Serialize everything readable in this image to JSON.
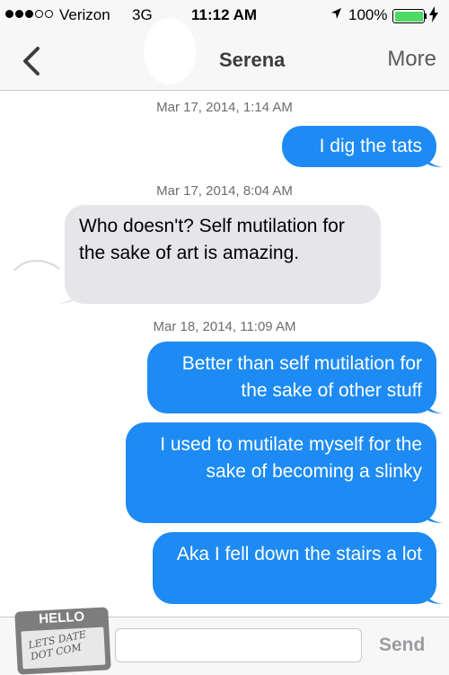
{
  "status_bar": {
    "carrier": "Verizon",
    "network": "3G",
    "time": "11:12 AM",
    "battery": "100%",
    "signal_bars": 3,
    "signal_total": 5
  },
  "nav": {
    "back_icon": "chevron-left-icon",
    "title": "Serena",
    "more_label": "More"
  },
  "messages": [
    {
      "type": "timestamp",
      "text": "Mar 17, 2014, 1:14 AM"
    },
    {
      "type": "sent",
      "text": "I dig the tats"
    },
    {
      "type": "timestamp",
      "text": "Mar 17, 2014, 8:04 AM"
    },
    {
      "type": "received",
      "text": "Who doesn't?  Self mutilation for the sake of art is amazing."
    },
    {
      "type": "timestamp",
      "text": "Mar 18, 2014, 11:09 AM"
    },
    {
      "type": "sent",
      "text": "Better than self mutilation for the sake of other stuff"
    },
    {
      "type": "sent",
      "text": "I used to mutilate myself for the sake of becoming a slinky"
    },
    {
      "type": "sent",
      "text": "Aka I fell down the stairs a lot"
    }
  ],
  "input_bar": {
    "send_label": "Send"
  },
  "watermark": {
    "hello": "HELLO",
    "handwriting": "LETS DATE DOT COM"
  },
  "colors": {
    "sent_bubble": "#1d8bf3",
    "received_bubble": "#e5e5ea",
    "battery": "#4cd964"
  }
}
